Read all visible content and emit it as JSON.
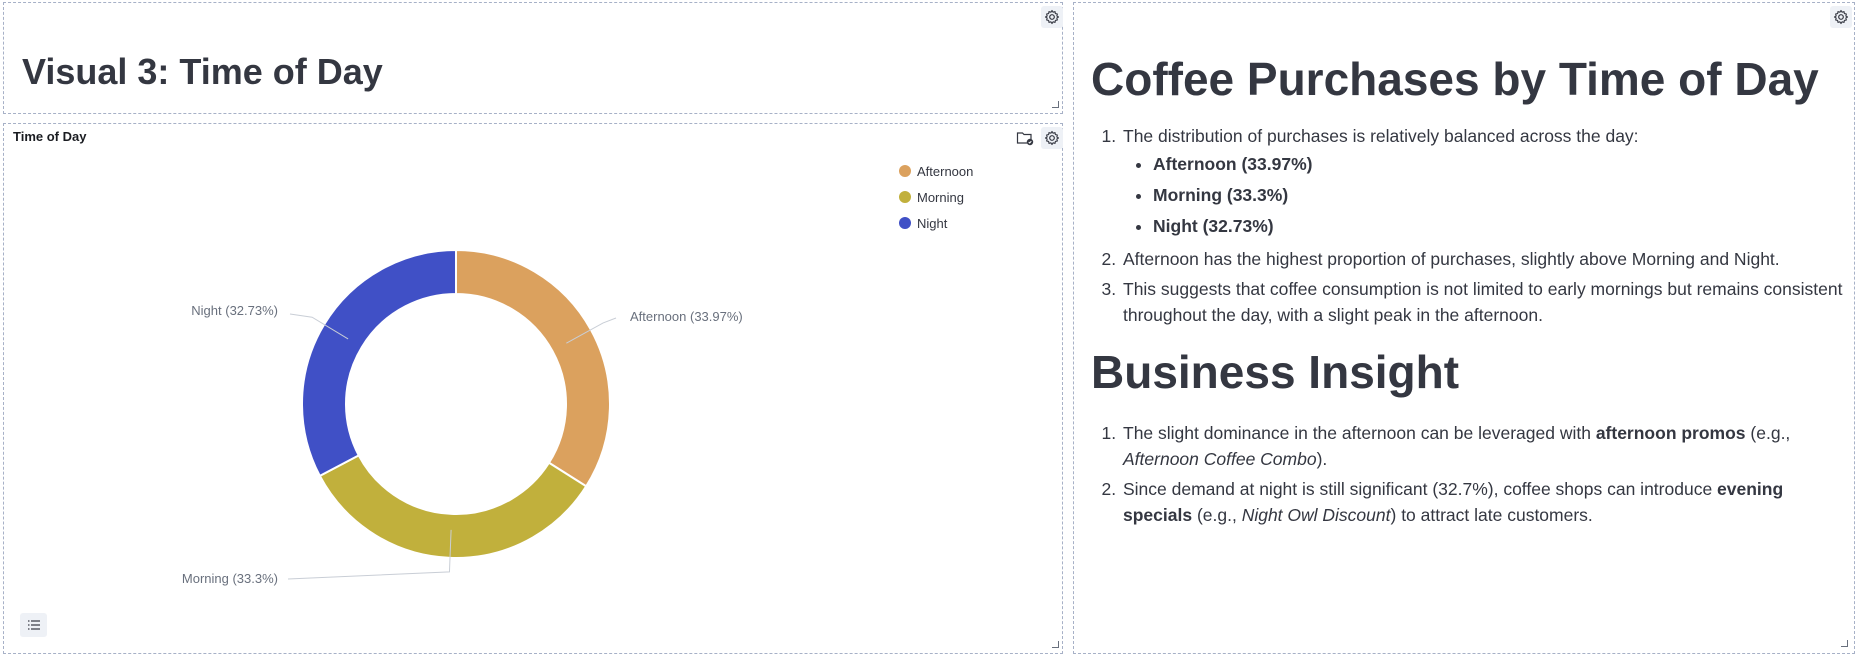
{
  "title_panel": {
    "heading": "Visual 3: Time of Day"
  },
  "chart_panel": {
    "title": "Time of Day",
    "list_icon": "list-icon",
    "gear_icon": "gear-icon",
    "folder_icon": "folder-info-icon"
  },
  "chart_data": {
    "type": "pie",
    "title": "Time of Day",
    "donut": true,
    "legend_placement": "top-right",
    "slices": [
      {
        "label": "Afternoon",
        "value": 33.97,
        "color": "#dba15e",
        "data_label": "Afternoon (33.97%)"
      },
      {
        "label": "Morning",
        "value": 33.3,
        "color": "#c1b03c",
        "data_label": "Morning (33.3%)"
      },
      {
        "label": "Night",
        "value": 32.73,
        "color": "#4050c6",
        "data_label": "Night (32.73%)"
      }
    ]
  },
  "text_panel": {
    "h1": "Coffee Purchases by Time of Day",
    "item1": "The distribution of purchases is relatively balanced across the day:",
    "bullets": [
      "Afternoon (33.97%)",
      "Morning (33.3%)",
      "Night (32.73%)"
    ],
    "item2": "Afternoon has the highest proportion of purchases, slightly above Morning and Night.",
    "item3": "This suggests that coffee consumption is not limited to early mornings but remains consistent throughout the day, with a slight peak in the afternoon.",
    "h2": "Business Insight",
    "insight1": {
      "pre": "The slight dominance in the afternoon can be leveraged with ",
      "bold": "afternoon promos",
      "mid": " (e.g., ",
      "italic": "Afternoon Coffee Combo",
      "post": ")."
    },
    "insight2": {
      "pre": "Since demand at night is still significant (32.7%), coffee shops can introduce ",
      "bold": "evening specials",
      "mid": " (e.g., ",
      "italic": "Night Owl Discount",
      "post": ") to attract late customers."
    }
  }
}
